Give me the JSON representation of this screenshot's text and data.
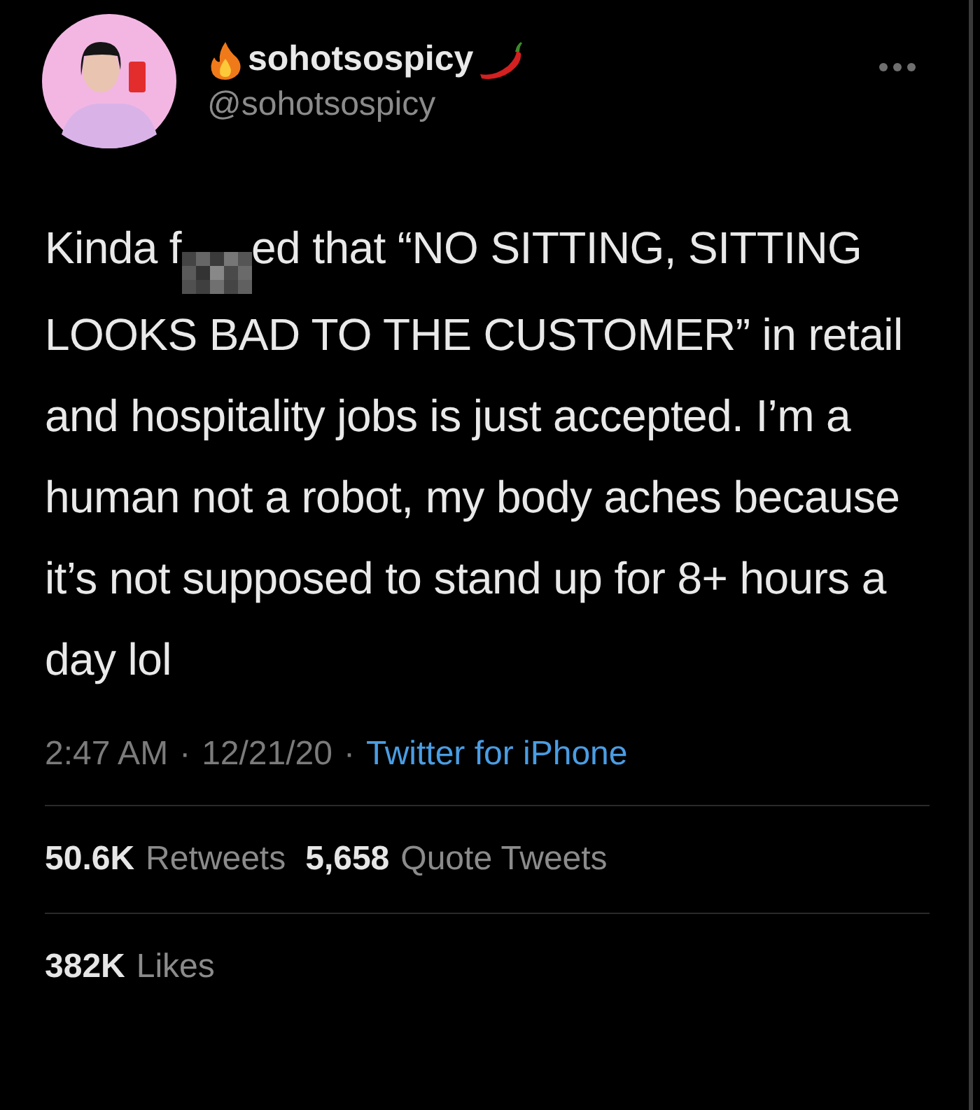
{
  "author": {
    "display_name": "sohotsospicy",
    "handle": "@sohotsospicy"
  },
  "tweet": {
    "before_censor": "Kinda f",
    "censored": true,
    "after_censor": "ed that “NO SITTING, SITTING LOOKS BAD TO THE CUSTOMER” in retail and hospitality jobs is just accepted. I’m a human not a robot, my body aches because it’s not supposed to stand up for 8+ hours a day lol"
  },
  "meta": {
    "time": "2:47 AM",
    "separator": "·",
    "date": "12/21/20",
    "separator_2": "·",
    "source": "Twitter for iPhone"
  },
  "stats": [
    {
      "count": "50.6K",
      "label": "Retweets"
    },
    {
      "count": "5,658",
      "label": "Quote Tweets"
    }
  ],
  "likes": {
    "count": "382K",
    "label": "Likes"
  }
}
